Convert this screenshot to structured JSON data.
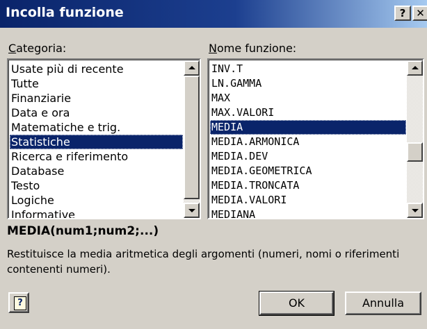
{
  "window": {
    "title": "Incolla funzione",
    "help_glyph": "?",
    "close_glyph": "✕"
  },
  "category": {
    "label_key": "C",
    "label_rest": "ategoria:",
    "items": [
      "Usate più di recente",
      "Tutte",
      "Finanziarie",
      "Data e ora",
      "Matematiche e trig.",
      "Statistiche",
      "Ricerca e riferimento",
      "Database",
      "Testo",
      "Logiche",
      "Informative"
    ],
    "selected": "Statistiche"
  },
  "function": {
    "label_key": "N",
    "label_rest": "ome funzione:",
    "items": [
      "INV.T",
      "LN.GAMMA",
      "MAX",
      "MAX.VALORI",
      "MEDIA",
      "MEDIA.ARMONICA",
      "MEDIA.DEV",
      "MEDIA.GEOMETRICA",
      "MEDIA.TRONCATA",
      "MEDIA.VALORI",
      "MEDIANA"
    ],
    "selected": "MEDIA"
  },
  "syntax": "MEDIA(num1;num2;...)",
  "description": "Restituisce la media aritmetica degli argomenti (numeri, nomi o riferimenti contenenti numeri).",
  "buttons": {
    "help_icon": "?",
    "ok": "OK",
    "cancel": "Annulla"
  },
  "icons": {
    "scroll_up": "arrow-up-icon",
    "scroll_down": "arrow-down-icon",
    "help": "help-icon"
  }
}
